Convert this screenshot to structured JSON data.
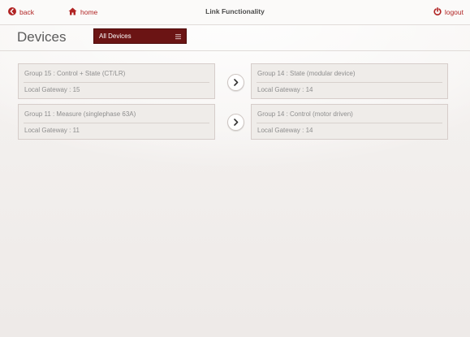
{
  "topbar": {
    "back_label": "back",
    "home_label": "home",
    "title": "Link Functionality",
    "logout_label": "logout"
  },
  "header": {
    "title": "Devices",
    "dropdown_value": "All Devices"
  },
  "links": [
    {
      "source": {
        "group": "Group 15 : Control + State (CT/LR)",
        "gateway": "Local Gateway : 15"
      },
      "target": {
        "group": "Group 14 : State (modular device)",
        "gateway": "Local Gateway : 14"
      }
    },
    {
      "source": {
        "group": "Group 11 : Measure (singlephase 63A)",
        "gateway": "Local Gateway : 11"
      },
      "target": {
        "group": "Group 14 : Control (motor driven)",
        "gateway": "Local Gateway : 14"
      }
    }
  ],
  "colors": {
    "accent": "#b12424",
    "dropdown_bg": "#6b1414",
    "card_bg": "#efece9",
    "card_border": "#d6cdca"
  },
  "icons": {
    "back": "back-circle-arrow-icon",
    "home": "home-icon",
    "logout": "power-icon",
    "dropdown": "menu-icon",
    "link": "chevron-right-icon"
  }
}
